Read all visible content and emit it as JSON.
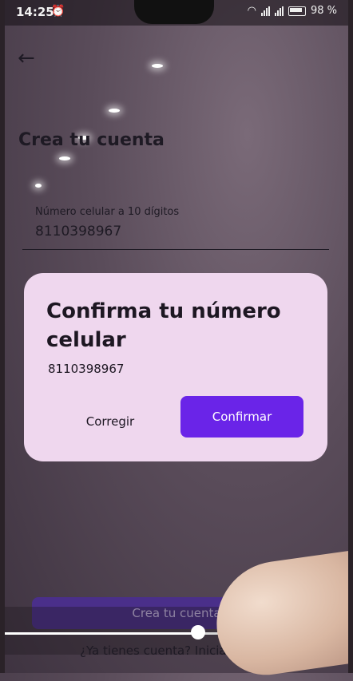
{
  "status_bar": {
    "time": "14:25",
    "battery_percent": "98 %"
  },
  "header": {
    "back_icon": "arrow-left-icon"
  },
  "page": {
    "title": "Crea tu cuenta",
    "phone_field": {
      "label": "Número celular a 10 dígitos",
      "value": "8110398967"
    },
    "primary_button_label": "Crea tu cuenta",
    "login_prompt": "¿Ya tienes cuenta? Inicia sesión"
  },
  "dialog": {
    "title": "Confirma tu número celular",
    "number": "8110398967",
    "cancel_label": "Corregir",
    "confirm_label": "Confirmar",
    "confirm_color": "#6a24e8"
  },
  "video_player": {
    "progress": 0.56
  }
}
